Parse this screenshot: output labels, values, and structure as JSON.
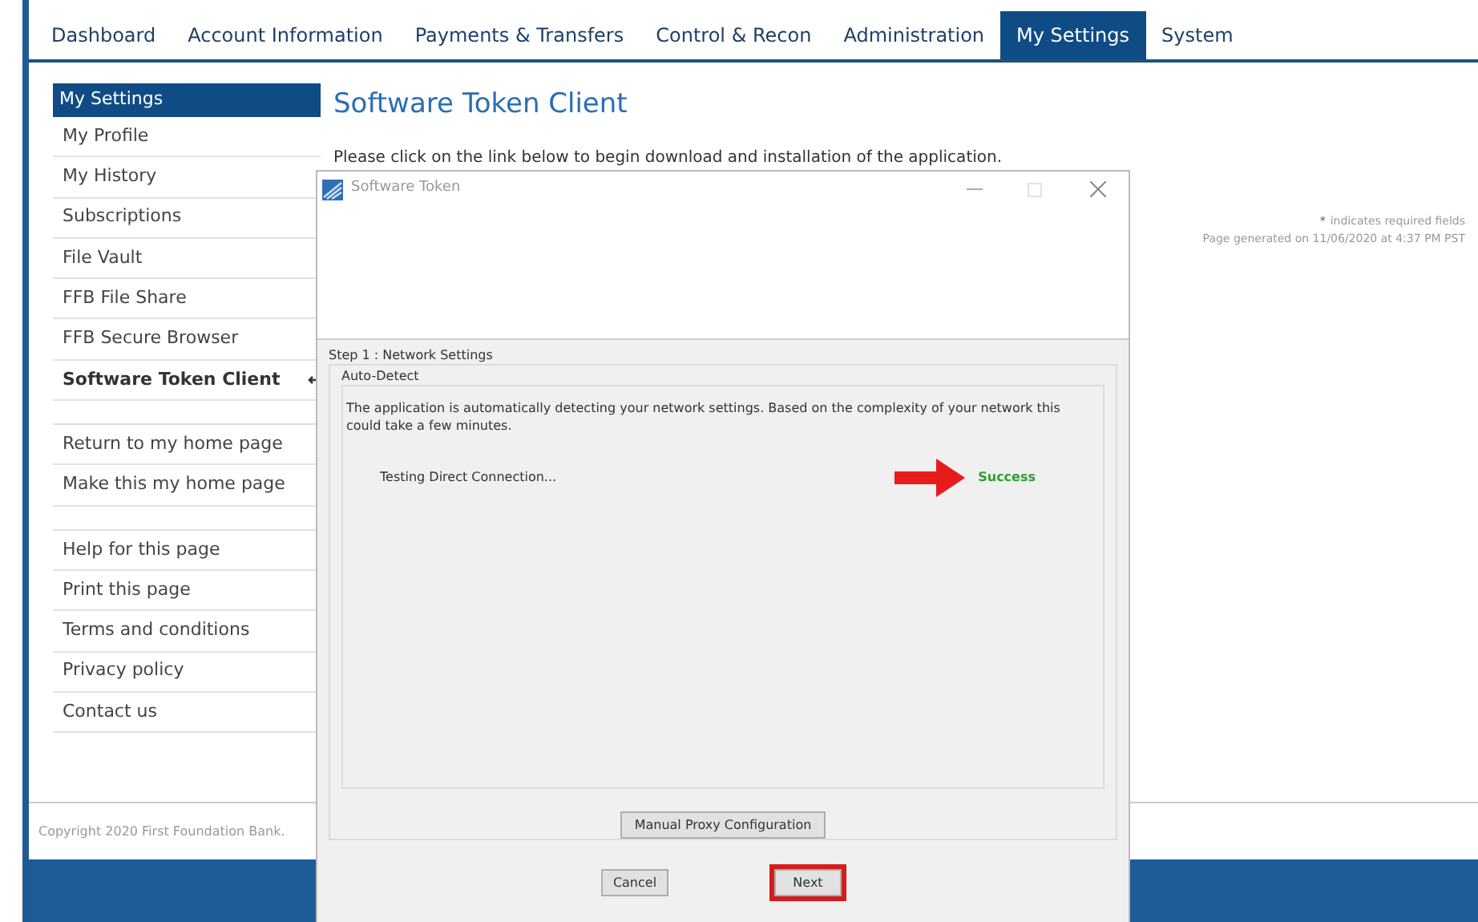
{
  "nav_tabs": [
    {
      "label": "Dashboard",
      "selected": false
    },
    {
      "label": "Account Information",
      "selected": false
    },
    {
      "label": "Payments & Transfers",
      "selected": false
    },
    {
      "label": "Control & Recon",
      "selected": false
    },
    {
      "label": "Administration",
      "selected": false
    },
    {
      "label": "My Settings",
      "selected": true
    },
    {
      "label": "System",
      "selected": false
    }
  ],
  "sidebar": {
    "header": "My Settings",
    "groups": [
      [
        {
          "label": "My Profile",
          "current": false
        },
        {
          "label": "My History",
          "current": false
        },
        {
          "label": "Subscriptions",
          "current": false
        },
        {
          "label": "File Vault",
          "current": false
        },
        {
          "label": "FFB File Share",
          "current": false
        },
        {
          "label": "FFB Secure Browser",
          "current": false
        },
        {
          "label": "Software Token Client",
          "current": true
        }
      ],
      [
        {
          "label": "Return to my home page",
          "current": false
        },
        {
          "label": "Make this my home page",
          "current": false
        }
      ],
      [
        {
          "label": "Help for this page",
          "current": false
        },
        {
          "label": "Print this page",
          "current": false
        },
        {
          "label": "Terms and conditions",
          "current": false
        },
        {
          "label": "Privacy policy",
          "current": false
        },
        {
          "label": "Contact us",
          "current": false
        }
      ]
    ]
  },
  "page": {
    "title": "Software Token Client",
    "instruction": "Please click on the link below to begin download and installation of the application.",
    "required_mark": "*",
    "required_note": "indicates required fields",
    "generated": "Page generated on 11/06/2020 at 4:37 PM PST"
  },
  "footer": {
    "copyright": "Copyright 2020 First Foundation Bank."
  },
  "dialog": {
    "title": "Software Token",
    "step_legend": "Step 1 : Network Settings",
    "group_legend": "Auto-Detect",
    "message": "The application is automatically detecting your network settings. Based on the complexity of your network this could take a few minutes.",
    "test_label": "Testing Direct Connection...",
    "test_result": "Success",
    "proxy_button": "Manual Proxy Configuration",
    "buttons": [
      {
        "label": "Cancel",
        "highlighted": false
      },
      {
        "label": "Next",
        "highlighted": true
      }
    ]
  }
}
